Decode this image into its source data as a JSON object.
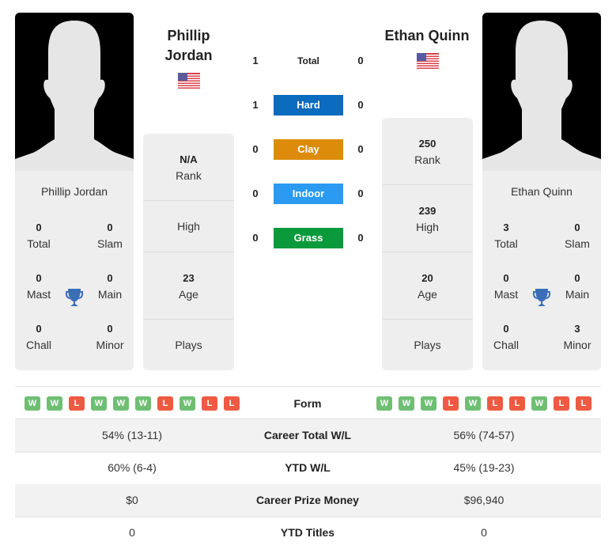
{
  "player1": {
    "name": "Phillip Jordan",
    "name_line1": "Phillip",
    "name_line2": "Jordan",
    "country_flag": "us-flag-icon",
    "titles": {
      "total": {
        "value": "0",
        "label": "Total"
      },
      "slam": {
        "value": "0",
        "label": "Slam"
      },
      "mast": {
        "value": "0",
        "label": "Mast"
      },
      "main": {
        "value": "0",
        "label": "Main"
      },
      "chall": {
        "value": "0",
        "label": "Chall"
      },
      "minor": {
        "value": "0",
        "label": "Minor"
      }
    },
    "stats": {
      "rank": {
        "value": "N/A",
        "label": "Rank"
      },
      "high": {
        "value": "",
        "label": "High"
      },
      "age": {
        "value": "23",
        "label": "Age"
      },
      "plays": {
        "value": "",
        "label": "Plays"
      }
    },
    "form": [
      "W",
      "W",
      "L",
      "W",
      "W",
      "W",
      "L",
      "W",
      "L",
      "L"
    ]
  },
  "player2": {
    "name": "Ethan Quinn",
    "country_flag": "us-flag-icon",
    "titles": {
      "total": {
        "value": "3",
        "label": "Total"
      },
      "slam": {
        "value": "0",
        "label": "Slam"
      },
      "mast": {
        "value": "0",
        "label": "Mast"
      },
      "main": {
        "value": "0",
        "label": "Main"
      },
      "chall": {
        "value": "0",
        "label": "Chall"
      },
      "minor": {
        "value": "3",
        "label": "Minor"
      }
    },
    "stats": {
      "rank": {
        "value": "250",
        "label": "Rank"
      },
      "high": {
        "value": "239",
        "label": "High"
      },
      "age": {
        "value": "20",
        "label": "Age"
      },
      "plays": {
        "value": "",
        "label": "Plays"
      }
    },
    "form": [
      "W",
      "W",
      "W",
      "L",
      "W",
      "L",
      "L",
      "W",
      "L",
      "L"
    ]
  },
  "h2h": [
    {
      "label": "Total",
      "p1": "1",
      "p2": "0",
      "color": ""
    },
    {
      "label": "Hard",
      "p1": "1",
      "p2": "0",
      "color": "#0a6bbf"
    },
    {
      "label": "Clay",
      "p1": "0",
      "p2": "0",
      "color": "#dc8c0a"
    },
    {
      "label": "Indoor",
      "p1": "0",
      "p2": "0",
      "color": "#2a9af2"
    },
    {
      "label": "Grass",
      "p1": "0",
      "p2": "0",
      "color": "#0a9a3c"
    }
  ],
  "form_label": "Form",
  "comparison": [
    {
      "label": "Career Total W/L",
      "p1": "54% (13-11)",
      "p2": "56% (74-57)"
    },
    {
      "label": "YTD W/L",
      "p1": "60% (6-4)",
      "p2": "45% (19-23)"
    },
    {
      "label": "Career Prize Money",
      "p1": "$0",
      "p2": "$96,940"
    },
    {
      "label": "YTD Titles",
      "p1": "0",
      "p2": "0"
    }
  ],
  "colors": {
    "win": "#6fbf73",
    "loss": "#ee5a42",
    "trophy": "#3a6fb8",
    "card_bg": "#eeeeee"
  }
}
